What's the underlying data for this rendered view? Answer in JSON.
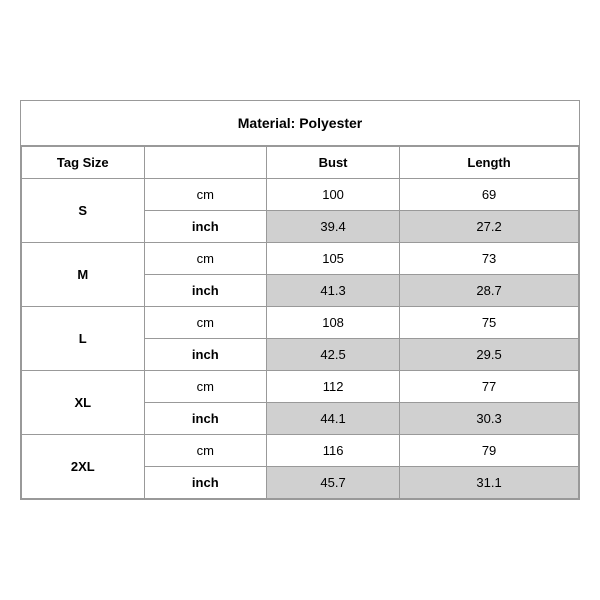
{
  "title": "Material: Polyester",
  "columns": {
    "tag_size": "Tag Size",
    "bust": "Bust",
    "length": "Length"
  },
  "sizes": [
    {
      "tag": "S",
      "cm": {
        "bust": "100",
        "length": "69"
      },
      "inch": {
        "bust": "39.4",
        "length": "27.2"
      }
    },
    {
      "tag": "M",
      "cm": {
        "bust": "105",
        "length": "73"
      },
      "inch": {
        "bust": "41.3",
        "length": "28.7"
      }
    },
    {
      "tag": "L",
      "cm": {
        "bust": "108",
        "length": "75"
      },
      "inch": {
        "bust": "42.5",
        "length": "29.5"
      }
    },
    {
      "tag": "XL",
      "cm": {
        "bust": "112",
        "length": "77"
      },
      "inch": {
        "bust": "44.1",
        "length": "30.3"
      }
    },
    {
      "tag": "2XL",
      "cm": {
        "bust": "116",
        "length": "79"
      },
      "inch": {
        "bust": "45.7",
        "length": "31.1"
      }
    }
  ],
  "units": {
    "cm": "cm",
    "inch": "inch"
  }
}
